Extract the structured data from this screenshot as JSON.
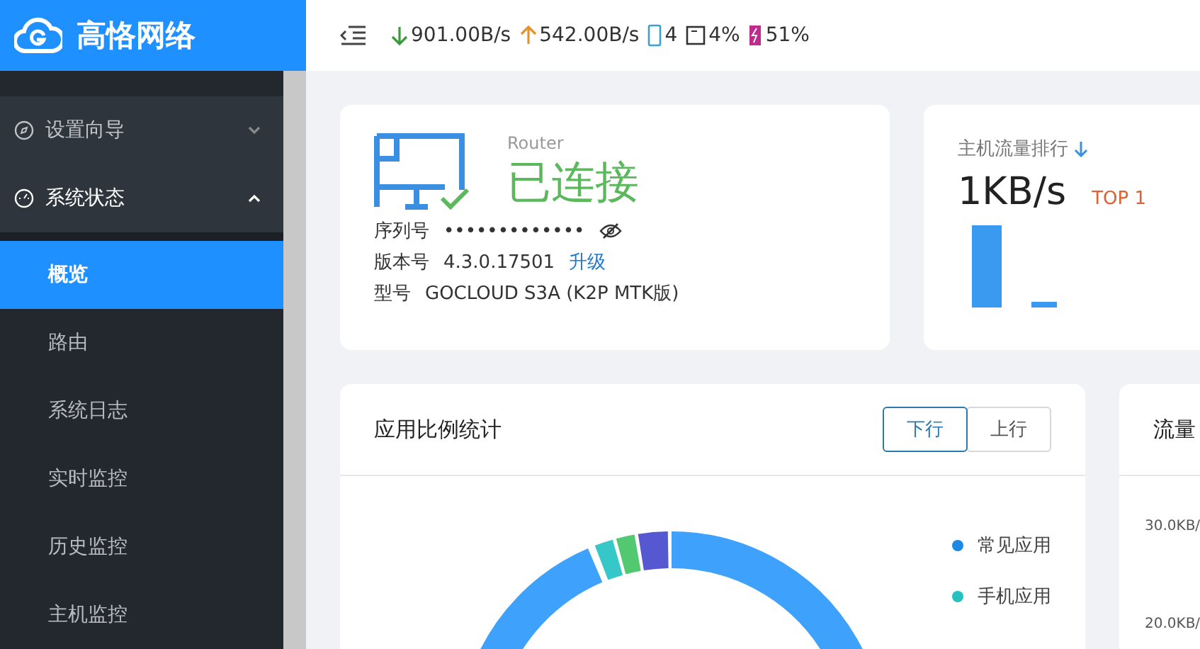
{
  "logo": {
    "text": "高恪网络"
  },
  "status": [
    {
      "kind": "download",
      "text": "901.00B/s"
    },
    {
      "kind": "upload",
      "text": "542.00B/s"
    },
    {
      "kind": "devices",
      "text": "4"
    },
    {
      "kind": "cpu",
      "text": "4%"
    },
    {
      "kind": "memory",
      "text": "51%"
    }
  ],
  "sidebar": {
    "items": [
      {
        "label": "设置向导",
        "kind": "compass",
        "expanded": false
      },
      {
        "label": "系统状态",
        "kind": "gauge",
        "expanded": true,
        "children": [
          {
            "label": "概览",
            "selected": true
          },
          {
            "label": "路由",
            "selected": false
          },
          {
            "label": "系统日志",
            "selected": false
          },
          {
            "label": "实时监控",
            "selected": false
          },
          {
            "label": "历史监控",
            "selected": false
          },
          {
            "label": "主机监控",
            "selected": false
          }
        ]
      }
    ]
  },
  "device_card": {
    "type": "Router",
    "status": "已连接",
    "fields": [
      {
        "label": "序列号",
        "value": "•••••••••••••",
        "kind": "secret"
      },
      {
        "label": "版本号",
        "value": "4.3.0.17501",
        "link": "升级",
        "kind": "version"
      },
      {
        "label": "型号",
        "value": "GOCLOUD S3A (K2P MTK版)",
        "kind": "plain"
      }
    ]
  },
  "host_card": {
    "title": "主机流量排行",
    "speed": "1KB/s",
    "rank": "TOP 1"
  },
  "app_card": {
    "title": "应用比例统计",
    "tabs": [
      {
        "label": "下行",
        "selected": true
      },
      {
        "label": "上行",
        "selected": false
      }
    ],
    "legend": [
      {
        "label": "常见应用",
        "color": "#1e88e5"
      },
      {
        "label": "手机应用",
        "color": "#26c0c0"
      }
    ]
  },
  "traffic_card": {
    "title": "流量",
    "y_tick_labels": [
      "30.0KB/",
      "20.0KB/"
    ]
  }
}
